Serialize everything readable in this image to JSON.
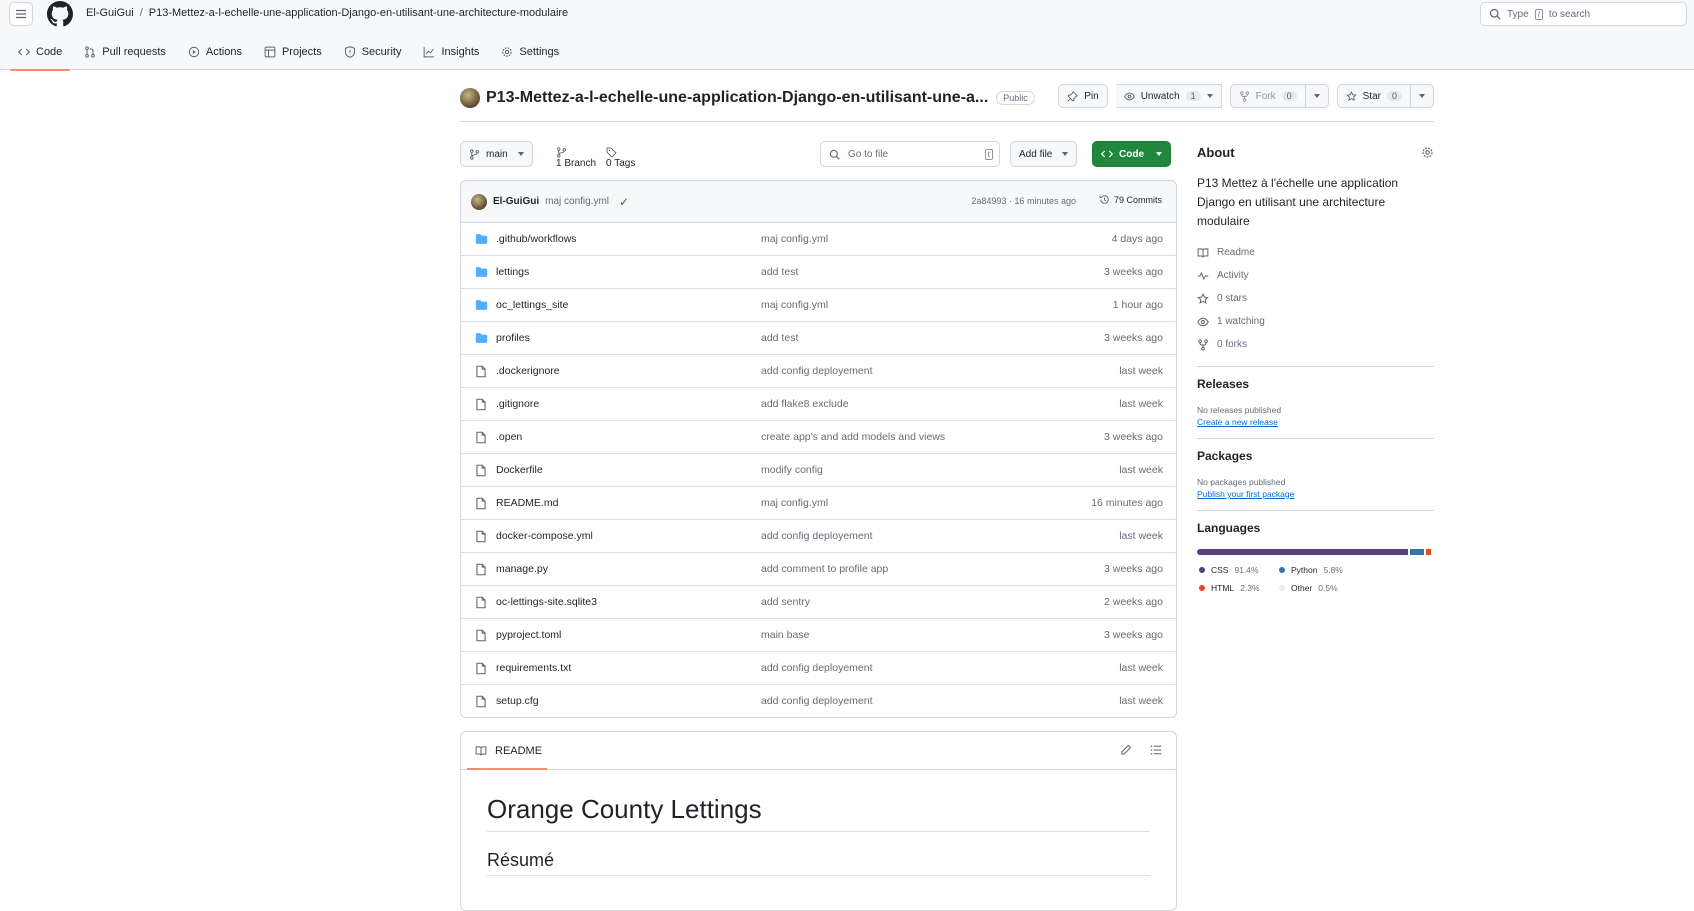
{
  "header": {
    "owner": "El-GuiGui",
    "separator": "/",
    "repo": "P13-Mettez-a-l-echelle-une-application-Django-en-utilisant-une-architecture-modulaire",
    "search_placeholder_prefix": "Type",
    "search_key": "/",
    "search_placeholder_suffix": "to search"
  },
  "nav": {
    "tabs": [
      {
        "label": "Code"
      },
      {
        "label": "Pull requests"
      },
      {
        "label": "Actions"
      },
      {
        "label": "Projects"
      },
      {
        "label": "Security"
      },
      {
        "label": "Insights"
      },
      {
        "label": "Settings"
      }
    ]
  },
  "repo": {
    "title": "P13-Mettez-a-l-echelle-une-application-Django-en-utilisant-une-a...",
    "visibility": "Public",
    "pin_label": "Pin",
    "unwatch_label": "Unwatch",
    "unwatch_count": "1",
    "fork_label": "Fork",
    "fork_count": "0",
    "star_label": "Star",
    "star_count": "0"
  },
  "toolbar": {
    "branch": "main",
    "branches": "1 Branch",
    "tags": "0 Tags",
    "goto_placeholder": "Go to file",
    "goto_key": "t",
    "add_file": "Add file",
    "code": "Code"
  },
  "commit": {
    "author": "El-GuiGui",
    "message": "maj config.yml",
    "check": "✓",
    "meta": "2a84993 · 16 minutes ago",
    "count": "79 Commits"
  },
  "files": [
    {
      "name": ".github/workflows",
      "type": "dir",
      "message": "maj config.yml",
      "date": "4 days ago"
    },
    {
      "name": "lettings",
      "type": "dir",
      "message": "add test",
      "date": "3 weeks ago"
    },
    {
      "name": "oc_lettings_site",
      "type": "dir",
      "message": "maj config.yml",
      "date": "1 hour ago"
    },
    {
      "name": "profiles",
      "type": "dir",
      "message": "add test",
      "date": "3 weeks ago"
    },
    {
      "name": ".dockerignore",
      "type": "file",
      "message": "add config deployement",
      "date": "last week"
    },
    {
      "name": ".gitignore",
      "type": "file",
      "message": "add flake8 exclude",
      "date": "last week"
    },
    {
      "name": ".open",
      "type": "file",
      "message": "create app's and add models and views",
      "date": "3 weeks ago"
    },
    {
      "name": "Dockerfile",
      "type": "file",
      "message": "modify config",
      "date": "last week"
    },
    {
      "name": "README.md",
      "type": "file",
      "message": "maj config.yml",
      "date": "16 minutes ago"
    },
    {
      "name": "docker-compose.yml",
      "type": "file",
      "message": "add config deployement",
      "date": "last week"
    },
    {
      "name": "manage.py",
      "type": "file",
      "message": "add comment to profile app",
      "date": "3 weeks ago"
    },
    {
      "name": "oc-lettings-site.sqlite3",
      "type": "file",
      "message": "add sentry",
      "date": "2 weeks ago"
    },
    {
      "name": "pyproject.toml",
      "type": "file",
      "message": "main base",
      "date": "3 weeks ago"
    },
    {
      "name": "requirements.txt",
      "type": "file",
      "message": "add config deployement",
      "date": "last week"
    },
    {
      "name": "setup.cfg",
      "type": "file",
      "message": "add config deployement",
      "date": "last week"
    }
  ],
  "readme": {
    "tab": "README",
    "h1": "Orange County Lettings",
    "h2": "Résumé"
  },
  "about": {
    "title": "About",
    "description": "P13 Mettez à l'échelle une application Django en utilisant une architecture modulaire",
    "items": [
      {
        "icon": "book-icon",
        "label": "Readme"
      },
      {
        "icon": "pulse-icon",
        "label": "Activity"
      },
      {
        "icon": "star-icon",
        "label": "0 stars"
      },
      {
        "icon": "eye-icon",
        "label": "1 watching"
      },
      {
        "icon": "fork-icon",
        "label": "0 forks"
      }
    ]
  },
  "releases": {
    "title": "Releases",
    "empty": "No releases published",
    "link": "Create a new release"
  },
  "packages": {
    "title": "Packages",
    "empty": "No packages published",
    "link": "Publish your first package"
  },
  "languages": {
    "title": "Languages",
    "items": [
      {
        "name": "CSS",
        "pct": "91.4%",
        "value": 91.4,
        "color": "#563d7c"
      },
      {
        "name": "Python",
        "pct": "5.8%",
        "value": 5.8,
        "color": "#3572A5"
      },
      {
        "name": "HTML",
        "pct": "2.3%",
        "value": 2.3,
        "color": "#e34c26"
      },
      {
        "name": "Other",
        "pct": "0.5%",
        "value": 0.5,
        "color": "#ededed"
      }
    ]
  },
  "colors": {
    "accent_green": "#1f883d",
    "folder_blue": "#54aeff",
    "underline": "#fd8c73",
    "link": "#0969da"
  }
}
